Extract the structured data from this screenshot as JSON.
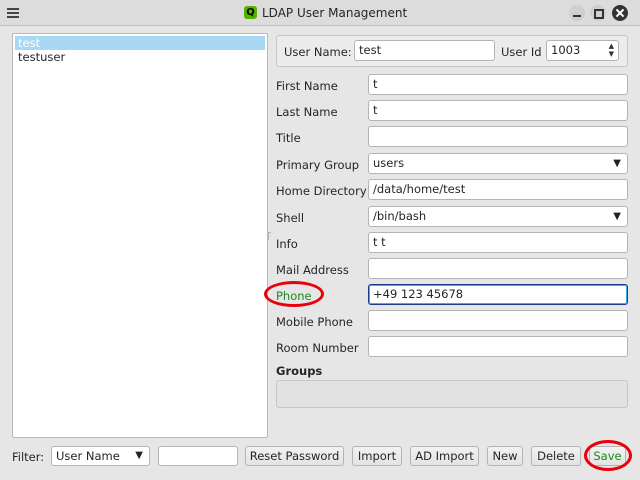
{
  "window": {
    "title": "LDAP User Management",
    "app_icon_letter": "Q"
  },
  "users": [
    {
      "name": "test",
      "selected": true
    },
    {
      "name": "testuser",
      "selected": false
    }
  ],
  "header": {
    "user_name_label": "User Name:",
    "user_name_value": "test",
    "user_id_label": "User Id",
    "user_id_value": "1003"
  },
  "form": {
    "first_name_label": "First Name",
    "first_name_value": "t",
    "last_name_label": "Last Name",
    "last_name_value": "t",
    "title_label": "Title",
    "title_value": "",
    "primary_group_label": "Primary Group",
    "primary_group_value": "users",
    "home_directory_label": "Home Directory",
    "home_directory_value": "/data/home/test",
    "shell_label": "Shell",
    "shell_value": "/bin/bash",
    "info_label": "Info",
    "info_value": "t t",
    "mail_label": "Mail Address",
    "mail_value": "",
    "phone_label": "Phone",
    "phone_value": "+49 123 45678",
    "mobile_label": "Mobile Phone",
    "mobile_value": "",
    "room_label": "Room Number",
    "room_value": ""
  },
  "groups": {
    "label": "Groups"
  },
  "bottom": {
    "filter_label": "Filter:",
    "filter_combo_value": "User Name",
    "filter_input_value": "",
    "buttons": {
      "reset_password": "Reset Password",
      "import": "Import",
      "ad_import": "AD Import",
      "new": "New",
      "delete": "Delete",
      "save": "Save"
    }
  },
  "colors": {
    "highlight_red": "#e8000b",
    "label_green": "#1a8a1a",
    "selection": "#a9d8f4"
  }
}
